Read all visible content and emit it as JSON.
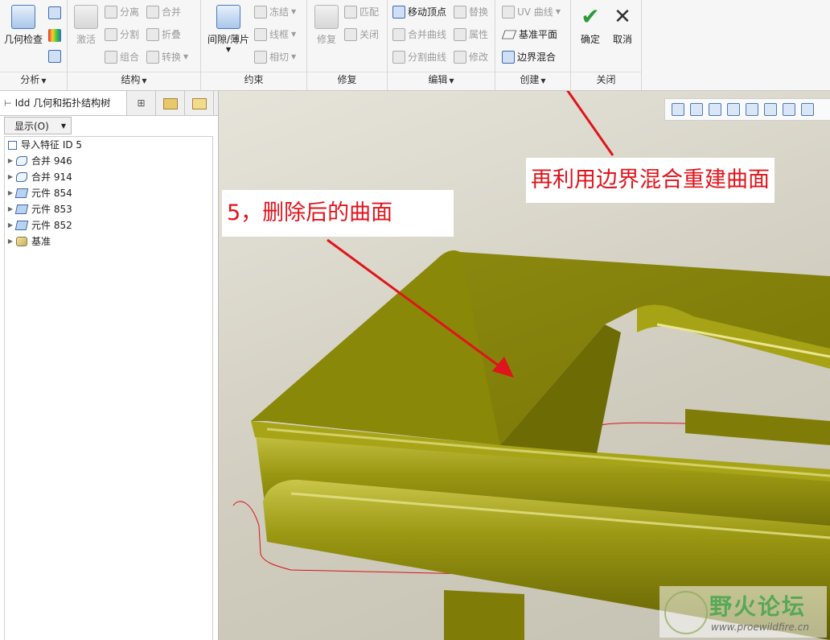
{
  "ribbon": {
    "analysis": {
      "group_label": "分析",
      "geometry_check": "几何检查"
    },
    "structure": {
      "group_label": "结构",
      "activate": "激活",
      "separate": "分离",
      "split": "分割",
      "combine": "组合",
      "merge": "合并",
      "fold": "折叠",
      "convert": "转换"
    },
    "constraint": {
      "group_label": "约束",
      "gap_sheet": "间隙/薄片",
      "freeze": "冻结",
      "wireframe": "线框",
      "tangent": "相切"
    },
    "repair": {
      "group_label": "修复",
      "repair": "修复",
      "match": "匹配",
      "close": "关闭"
    },
    "edit": {
      "group_label": "编辑",
      "move_vertex": "移动顶点",
      "replace": "替换",
      "merge_curve": "合并曲线",
      "attribute": "属性",
      "split_curve": "分割曲线",
      "modify": "修改"
    },
    "create": {
      "group_label": "创建",
      "uv_curve": "UV 曲线",
      "datum_plane": "基准平面",
      "boundary_blend": "边界混合"
    },
    "close": {
      "group_label": "关闭",
      "ok": "确定",
      "cancel": "取消"
    }
  },
  "left_panel": {
    "active_tab": "Idd 几何和拓扑结构树",
    "show_button": "显示(O)",
    "tree": [
      {
        "label": "导入特征 ID 5",
        "expandable": false
      },
      {
        "label": "合并 946",
        "expandable": true
      },
      {
        "label": "合并 914",
        "expandable": true
      },
      {
        "label": "元件 854",
        "expandable": true
      },
      {
        "label": "元件 853",
        "expandable": true
      },
      {
        "label": "元件 852",
        "expandable": true
      },
      {
        "label": "基准",
        "expandable": true
      }
    ]
  },
  "annotations": {
    "callout_top": "再利用边界混合重建曲面",
    "callout_mid": "5，删除后的曲面"
  },
  "watermark": {
    "title": "野火论坛",
    "url": "www.proewildfire.cn"
  },
  "colors": {
    "model": "#8a8a0a",
    "accent": "#3d6ba9",
    "annotation": "#e0141c",
    "confirm": "#2f9a3a"
  }
}
